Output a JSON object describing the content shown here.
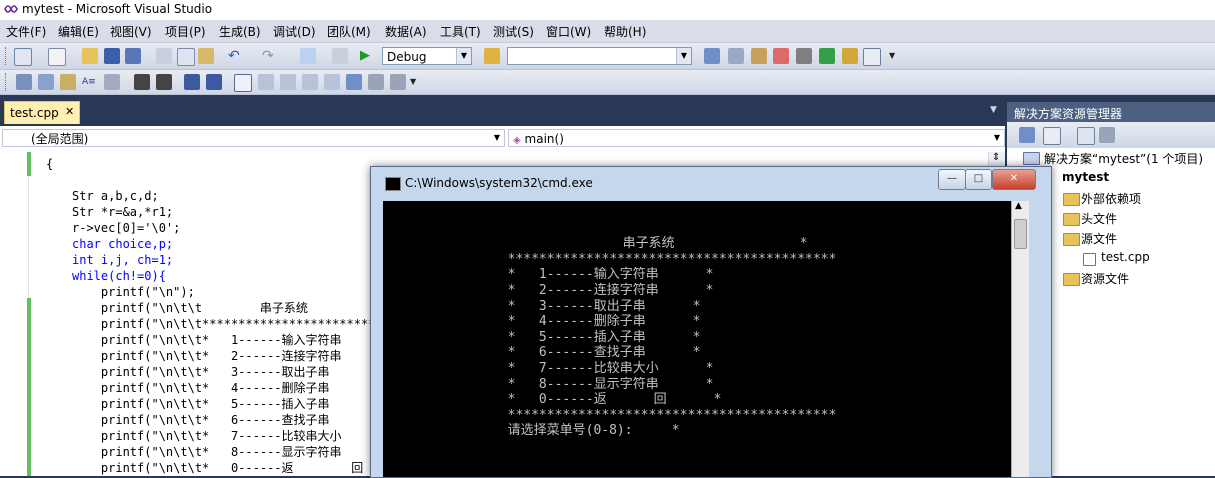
{
  "window": {
    "title": "mytest - Microsoft Visual Studio"
  },
  "menu": [
    "文件(F)",
    "编辑(E)",
    "视图(V)",
    "项目(P)",
    "生成(B)",
    "调试(D)",
    "团队(M)",
    "数据(A)",
    "工具(T)",
    "测试(S)",
    "窗口(W)",
    "帮助(H)"
  ],
  "toolbar": {
    "config_value": "Debug",
    "platform_value": ""
  },
  "editor": {
    "tab_label": "test.cpp",
    "scope": "(全局范围)",
    "function": "main()",
    "lines": [
      "{",
      "",
      "Str a,b,c,d;",
      "Str *r=&a,*r1;",
      "r->vec[0]='\\0';",
      "char choice,p;",
      "int i,j, ch=1;",
      "while(ch!=0){",
      "    printf(\"\\n\");",
      "    printf(\"\\n\\t\\t        串子系统",
      "    printf(\"\\n\\t\\t***************************",
      "    printf(\"\\n\\t\\t*   1------输入字符串",
      "    printf(\"\\n\\t\\t*   2------连接字符串",
      "    printf(\"\\n\\t\\t*   3------取出子串",
      "    printf(\"\\n\\t\\t*   4------删除子串",
      "    printf(\"\\n\\t\\t*   5------插入子串",
      "    printf(\"\\n\\t\\t*   6------查找子串",
      "    printf(\"\\n\\t\\t*   7------比较串大小",
      "    printf(\"\\n\\t\\t*   8------显示字符串",
      "    printf(\"\\n\\t\\t*   0------返        回"
    ]
  },
  "console": {
    "title": "C:\\Windows\\system32\\cmd.exe",
    "lines": [
      "",
      "",
      "              串子系统                *",
      "        ******************************************",
      "        *   1------输入字符串      *",
      "        *   2------连接字符串      *",
      "        *   3------取出子串      *",
      "        *   4------删除子串      *",
      "        *   5------插入子串      *",
      "        *   6------查找子串      *",
      "        *   7------比较串大小      *",
      "        *   8------显示字符串      *",
      "        *   0------返      回      *",
      "        ******************************************",
      "        请选择菜单号(0-8):     *"
    ]
  },
  "solution": {
    "header": "解决方案资源管理器",
    "solution_label": "解决方案“mytest”(1 个项目)",
    "project": "mytest",
    "items": [
      "外部依赖项",
      "头文件",
      "源文件",
      "test.cpp",
      "资源文件"
    ]
  }
}
